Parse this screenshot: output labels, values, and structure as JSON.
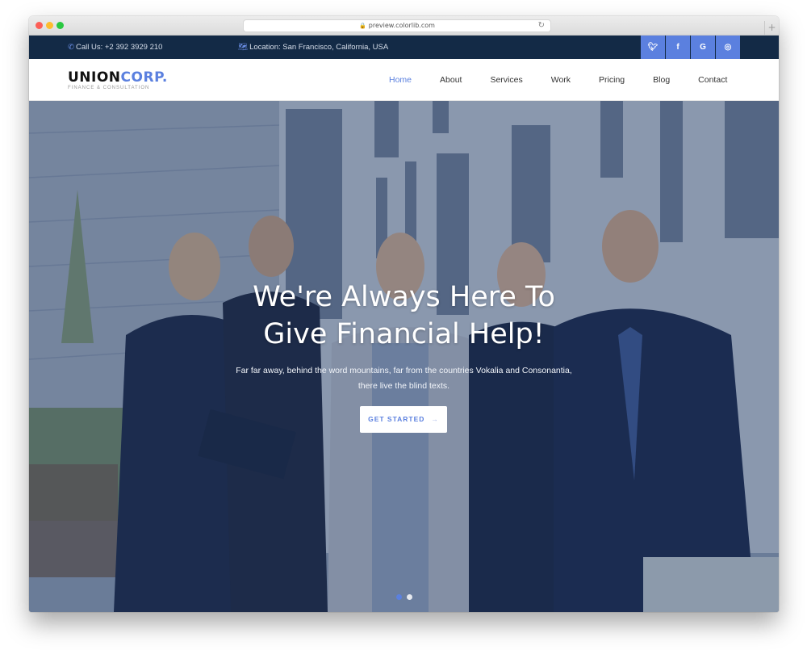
{
  "browser": {
    "url": "preview.colorlib.com",
    "lock_icon": "🔒",
    "reload_icon": "↻",
    "new_tab_icon": "+"
  },
  "topbar": {
    "phone_icon": "✆",
    "phone": "Call Us: +2 392 3929 210",
    "location_icon": "🗺",
    "location": "Location: San Francisco, California, USA",
    "social": [
      {
        "name": "twitter",
        "glyph": "🐦︎"
      },
      {
        "name": "facebook",
        "glyph": "f"
      },
      {
        "name": "google",
        "glyph": "G"
      },
      {
        "name": "instagram",
        "glyph": "◎"
      }
    ]
  },
  "logo": {
    "part1": "UNION",
    "part2": "CORP.",
    "tagline": "FINANCE & CONSULTATION"
  },
  "nav": {
    "items": [
      "Home",
      "About",
      "Services",
      "Work",
      "Pricing",
      "Blog",
      "Contact"
    ],
    "active": "Home"
  },
  "hero": {
    "title_line1": "We're Always Here To",
    "title_line2": "Give Financial Help!",
    "subtitle_line1": "Far far away, behind the word mountains, far from the countries Vokalia and Consonantia,",
    "subtitle_line2": "there live the blind texts.",
    "cta_label": "GET STARTED",
    "cta_arrow": "→",
    "slides": 2,
    "active_slide": 1
  },
  "colors": {
    "accent": "#5b80df",
    "topbar": "#132a46"
  }
}
